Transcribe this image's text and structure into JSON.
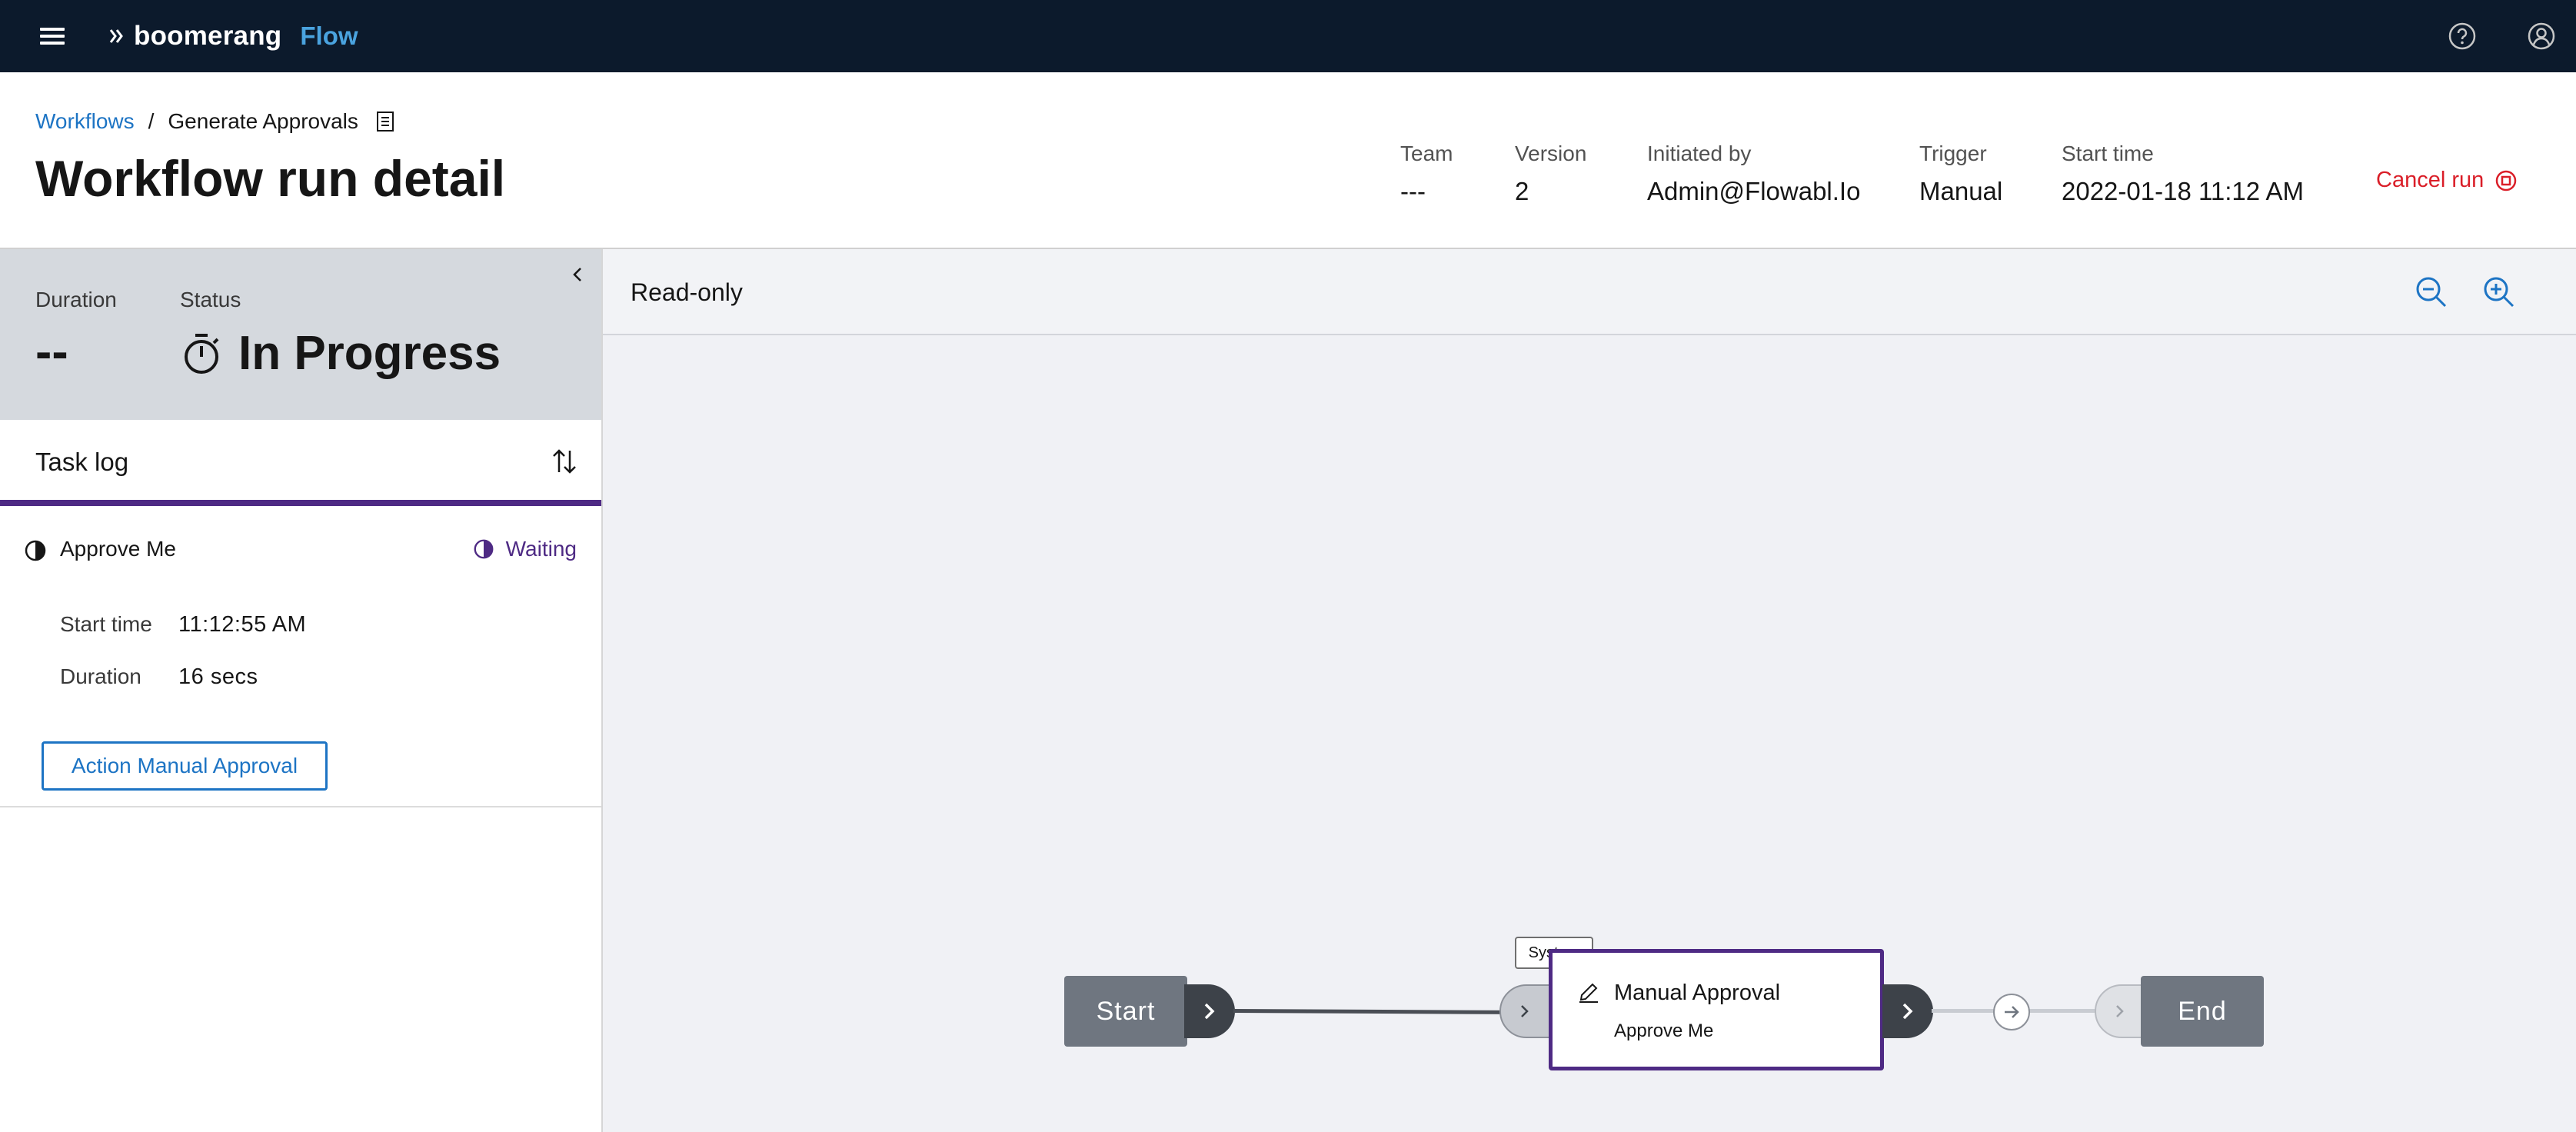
{
  "app": {
    "brand_name": "boomerang",
    "product_name": "Flow"
  },
  "breadcrumb": {
    "parent": "Workflows",
    "separator": "/",
    "current": "Generate Approvals"
  },
  "page": {
    "title": "Workflow run detail"
  },
  "meta": {
    "team_label": "Team",
    "team_value": "---",
    "version_label": "Version",
    "version_value": "2",
    "initiated_label": "Initiated by",
    "initiated_value": "Admin@Flowabl.Io",
    "trigger_label": "Trigger",
    "trigger_value": "Manual",
    "start_label": "Start time",
    "start_value": "2022-01-18 11:12 AM"
  },
  "actions": {
    "cancel_run": "Cancel run"
  },
  "summary": {
    "duration_label": "Duration",
    "duration_value": "--",
    "status_label": "Status",
    "status_value": "In Progress"
  },
  "task_log": {
    "title": "Task log",
    "items": [
      {
        "name": "Approve Me",
        "status": "Waiting",
        "start_label": "Start time",
        "start_value": "11:12:55 AM",
        "duration_label": "Duration",
        "duration_value": "16 secs",
        "action_label": "Action Manual Approval"
      }
    ]
  },
  "canvas": {
    "mode": "Read-only",
    "nodes": {
      "start_label": "Start",
      "end_label": "End",
      "task_tag": "System",
      "task_title": "Manual Approval",
      "task_subtitle": "Approve Me"
    }
  },
  "colors": {
    "topbar": "#0c1a2c",
    "brand_accent": "#4aa3df",
    "link": "#1d74c4",
    "danger": "#da1e28",
    "active_purple": "#4e2a84",
    "node_gray": "#6f7680"
  },
  "icons": {
    "menu": "hamburger-icon",
    "help": "help-icon",
    "user": "user-avatar-icon",
    "doc": "document-icon",
    "cancel": "stop-icon",
    "collapse": "chevron-left-icon",
    "timer": "timer-icon",
    "sort": "sort-arrows-icon",
    "zoom_out": "zoom-out-icon",
    "zoom_in": "zoom-in-icon",
    "edit": "pencil-icon"
  }
}
